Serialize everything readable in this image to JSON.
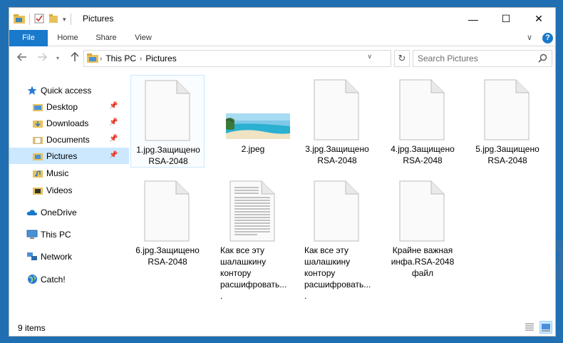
{
  "window": {
    "title": "Pictures",
    "min_glyph": "—",
    "max_glyph": "☐",
    "close_glyph": "✕"
  },
  "ribbon": {
    "tabs": [
      "File",
      "Home",
      "Share",
      "View"
    ],
    "expand_glyph": "∨",
    "help_glyph": "?"
  },
  "address": {
    "crumbs": [
      "This PC",
      "Pictures"
    ],
    "search_placeholder": "Search Pictures"
  },
  "navpane": {
    "quick_access": "Quick access",
    "pinned": [
      "Desktop",
      "Downloads",
      "Documents",
      "Pictures"
    ],
    "recent": [
      "Music",
      "Videos"
    ],
    "roots": [
      "OneDrive",
      "This PC",
      "Network",
      "Catch!"
    ],
    "selected": "Pictures"
  },
  "files": [
    {
      "lines": [
        "1.jpg.Защищено",
        "RSA-2048"
      ],
      "kind": "blank"
    },
    {
      "lines": [
        "2.jpeg"
      ],
      "kind": "image"
    },
    {
      "lines": [
        "3.jpg.Защищено",
        "RSA-2048"
      ],
      "kind": "blank"
    },
    {
      "lines": [
        "4.jpg.Защищено",
        "RSA-2048"
      ],
      "kind": "blank"
    },
    {
      "lines": [
        "5.jpg.Защищено",
        "RSA-2048"
      ],
      "kind": "blank"
    },
    {
      "lines": [
        "6.jpg.Защищено",
        "RSA-2048"
      ],
      "kind": "blank"
    },
    {
      "lines": [
        "Как все эту",
        "шалашкину",
        "контору",
        "расшифровать...."
      ],
      "kind": "text"
    },
    {
      "lines": [
        "Как все эту",
        "шалашкину",
        "контору",
        "расшифровать...."
      ],
      "kind": "blank"
    },
    {
      "lines": [
        "Крайне важная",
        "инфа.RSA-2048",
        "файл"
      ],
      "kind": "blank"
    }
  ],
  "status": {
    "item_count": "9 items"
  },
  "colors": {
    "accent": "#1979ca",
    "selection": "#cce8ff",
    "folder": "#e8c15a"
  }
}
